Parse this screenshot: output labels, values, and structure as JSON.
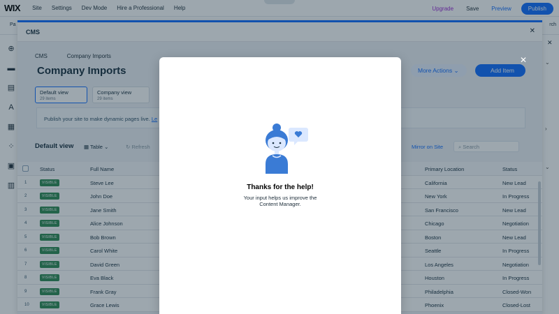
{
  "editor": {
    "logo": "WIX",
    "menu": [
      "Site",
      "Settings",
      "Dev Mode",
      "Hire a Professional",
      "Help"
    ],
    "upgrade": "Upgrade",
    "save": "Save",
    "preview": "Preview",
    "publish": "Publish",
    "strip_left": "Pa",
    "strip_right": "rch"
  },
  "cms": {
    "title": "CMS",
    "breadcrumb": [
      "CMS",
      "Company Imports"
    ],
    "page_title": "Company Imports",
    "more_actions": "More Actions",
    "add_item": "Add Item",
    "views": [
      {
        "name": "Default view",
        "count": "29 items"
      },
      {
        "name": "Company view",
        "count": "29 items"
      }
    ],
    "notice": "Publish your site to make dynamic pages live.",
    "notice_link": "Le",
    "toolbar": {
      "view_title": "Default view",
      "table": "Table",
      "refresh": "Refresh",
      "mirror": "Mirror on Site",
      "search_placeholder": "Search"
    },
    "columns": {
      "status": "Status",
      "full_name": "Full Name",
      "location": "Primary Location",
      "lead_status": "Status"
    },
    "badge_label": "VISIBLE",
    "rows": [
      {
        "n": "1",
        "name": "Steve Lee",
        "location": "California",
        "status": "New Lead"
      },
      {
        "n": "2",
        "name": "John Doe",
        "location": "New York",
        "status": "In Progress"
      },
      {
        "n": "3",
        "name": "Jane Smith",
        "location": "San Francisco",
        "status": "New Lead"
      },
      {
        "n": "4",
        "name": "Alice Johnson",
        "location": "Chicago",
        "status": "Negotiation"
      },
      {
        "n": "5",
        "name": "Bob Brown",
        "location": "Boston",
        "status": "New Lead"
      },
      {
        "n": "6",
        "name": "Carol White",
        "location": "Seattle",
        "status": "In Progress"
      },
      {
        "n": "7",
        "name": "David Green",
        "location": "Los Angeles",
        "status": "Negotiation"
      },
      {
        "n": "8",
        "name": "Eva Black",
        "location": "Houston",
        "status": "In Progress"
      },
      {
        "n": "9",
        "name": "Frank Gray",
        "location": "Philadelphia",
        "status": "Closed-Won"
      },
      {
        "n": "10",
        "name": "Grace Lewis",
        "location": "Phoenix",
        "status": "Closed-Lost"
      }
    ]
  },
  "dialog": {
    "title": "Thanks for the help!",
    "subtitle_line1": "Your input helps us improve the",
    "subtitle_line2": "Content Manager."
  },
  "colors": {
    "accent": "#116dff",
    "visible_badge": "#2e8a53",
    "upgrade": "#9a27d5"
  }
}
